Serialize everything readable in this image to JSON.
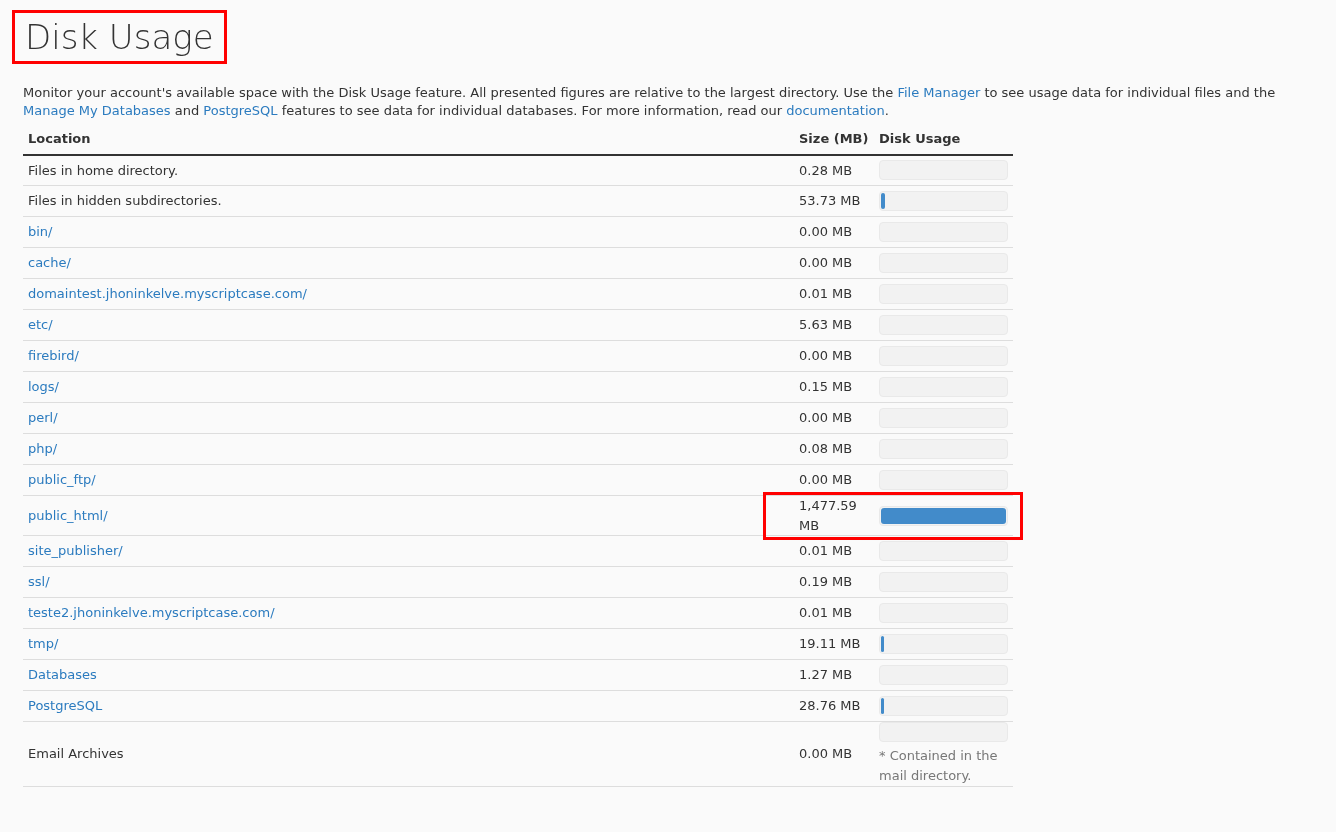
{
  "title": {
    "text": "Disk Usage",
    "highlighted": true
  },
  "intro": [
    {
      "text": "Monitor your account's available space with the Disk Usage feature. All presented figures are relative to the largest directory. Use the ",
      "link": false
    },
    {
      "text": "File Manager",
      "link": true
    },
    {
      "text": " to see usage data for individual files and the ",
      "link": false
    },
    {
      "text": "Manage My Databases",
      "link": true
    },
    {
      "text": " and ",
      "link": false
    },
    {
      "text": "PostgreSQL",
      "link": true
    },
    {
      "text": " features to see data for individual databases. For more information, read our ",
      "link": false
    },
    {
      "text": "documentation",
      "link": true
    },
    {
      "text": ".",
      "link": false
    }
  ],
  "table": {
    "columns": [
      "Location",
      "Size (MB)",
      "Disk Usage"
    ],
    "rows": [
      {
        "location": "Files in home directory.",
        "link": false,
        "size": "0.28 MB",
        "level": 0,
        "highlighted": false
      },
      {
        "location": "Files in hidden subdirectories.",
        "link": false,
        "size": "53.73 MB",
        "level": 0.03,
        "highlighted": false
      },
      {
        "location": "bin/",
        "link": true,
        "size": "0.00 MB",
        "level": 0,
        "highlighted": false
      },
      {
        "location": "cache/",
        "link": true,
        "size": "0.00 MB",
        "level": 0,
        "highlighted": false
      },
      {
        "location": "domaintest.jhoninkelve.myscriptcase.com/",
        "link": true,
        "size": "0.01 MB",
        "level": 0,
        "highlighted": false
      },
      {
        "location": "etc/",
        "link": true,
        "size": "5.63 MB",
        "level": 0,
        "highlighted": false
      },
      {
        "location": "firebird/",
        "link": true,
        "size": "0.00 MB",
        "level": 0,
        "highlighted": false
      },
      {
        "location": "logs/",
        "link": true,
        "size": "0.15 MB",
        "level": 0,
        "highlighted": false
      },
      {
        "location": "perl/",
        "link": true,
        "size": "0.00 MB",
        "level": 0,
        "highlighted": false
      },
      {
        "location": "php/",
        "link": true,
        "size": "0.08 MB",
        "level": 0,
        "highlighted": false
      },
      {
        "location": "public_ftp/",
        "link": true,
        "size": "0.00 MB",
        "level": 0,
        "highlighted": false
      },
      {
        "location": "public_html/",
        "link": true,
        "size": "1,477.59 MB",
        "level": 1,
        "highlighted": true
      },
      {
        "location": "site_publisher/",
        "link": true,
        "size": "0.01 MB",
        "level": 0,
        "highlighted": false
      },
      {
        "location": "ssl/",
        "link": true,
        "size": "0.19 MB",
        "level": 0,
        "highlighted": false
      },
      {
        "location": "teste2.jhoninkelve.myscriptcase.com/",
        "link": true,
        "size": "0.01 MB",
        "level": 0,
        "highlighted": false
      },
      {
        "location": "tmp/",
        "link": true,
        "size": "19.11 MB",
        "level": 0.02,
        "highlighted": false
      },
      {
        "location": "Databases",
        "link": true,
        "size": "1.27 MB",
        "level": 0,
        "highlighted": false
      },
      {
        "location": "PostgreSQL",
        "link": true,
        "size": "28.76 MB",
        "level": 0.02,
        "highlighted": false
      },
      {
        "location": "Email Archives",
        "link": false,
        "size": "0.00 MB",
        "level": 0,
        "highlighted": false,
        "note": "* Contained in the mail directory."
      }
    ]
  }
}
